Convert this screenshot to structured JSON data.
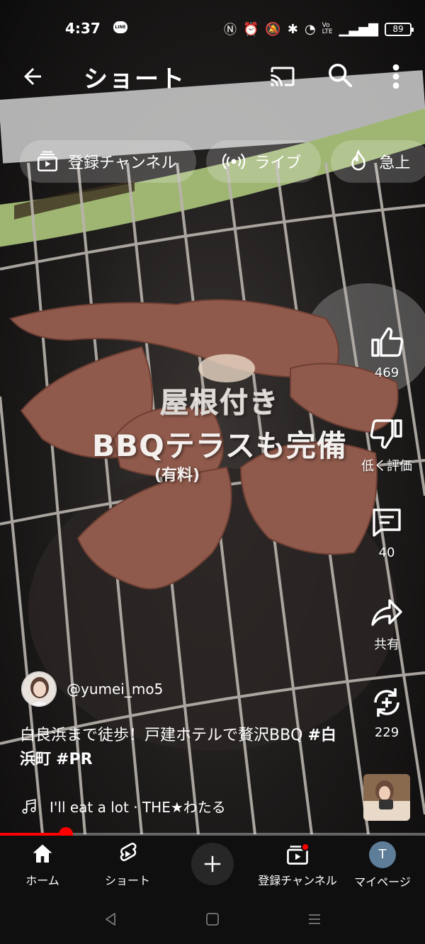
{
  "status_bar": {
    "time": "4:37",
    "line_badge": "LINE",
    "battery": "89"
  },
  "app_bar": {
    "title": "ショート",
    "back_icon": "arrow-back-icon",
    "cast_icon": "cast-icon",
    "search_icon": "search-icon",
    "more_icon": "more-vert-icon"
  },
  "chips": [
    {
      "label": "登録チャンネル",
      "icon": "subscriptions-icon"
    },
    {
      "label": "ライブ",
      "icon": "live-icon"
    },
    {
      "label": "急上",
      "icon": "trending-flame-icon"
    }
  ],
  "video_caption": {
    "line1": "屋根付き",
    "line2": "BBQテラスも完備",
    "line3": "(有料)"
  },
  "actions": {
    "like_count": "469",
    "dislike_label": "低く評価",
    "comment_count": "40",
    "share_label": "共有",
    "remix_count": "229"
  },
  "channel": {
    "handle": "@yumei_mo5"
  },
  "description": {
    "text": "白良浜まで徒歩！戸建ホテルで贅沢BBQ ",
    "tag1": "#白浜町",
    "tag2": "#PR"
  },
  "music": {
    "title": "I'll eat a lot · THE★わたる"
  },
  "progress": {
    "fraction": 0.155
  },
  "bottom_nav": {
    "home": "ホーム",
    "shorts": "ショート",
    "subscriptions": "登録チャンネル",
    "my_page": "マイページ",
    "avatar_letter": "T"
  },
  "colors": {
    "accent": "#ff0000",
    "background": "#0f0f0f",
    "chip_bg": "rgba(255,255,255,0.20)",
    "avatar_bg": "#5d7d98"
  }
}
